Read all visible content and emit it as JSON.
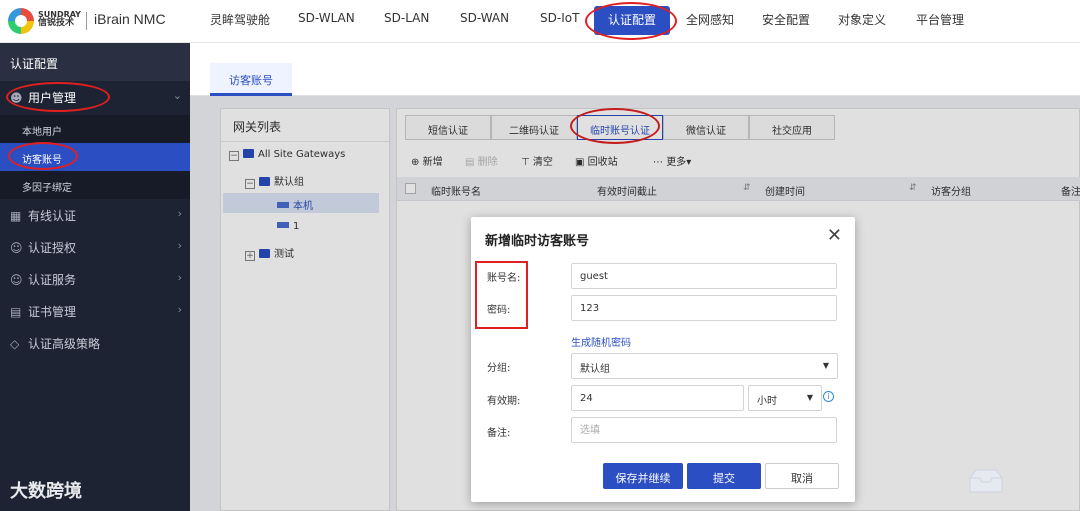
{
  "header": {
    "brand_en": "SUNDRAY",
    "brand_zh": "信锐技术",
    "product": "iBrain NMC",
    "nav": [
      "灵眸驾驶舱",
      "SD-WLAN",
      "SD-LAN",
      "SD-WAN",
      "SD-IoT",
      "认证配置",
      "全网感知",
      "安全配置",
      "对象定义",
      "平台管理"
    ],
    "active_nav": "认证配置"
  },
  "sidebar": {
    "title": "认证配置",
    "user_mgmt": "用户管理",
    "sub_local": "本地用户",
    "sub_guest": "访客账号",
    "sub_multi": "多因子绑定",
    "wired": "有线认证",
    "authz": "认证授权",
    "service": "认证服务",
    "cert": "证书管理",
    "advanced": "认证高级策略",
    "watermark": "大数跨境"
  },
  "page_tab": "访客账号",
  "gateway": {
    "title": "网关列表",
    "root": "All Site Gateways",
    "group": "默认组",
    "node_local": "本机",
    "node_1": "1",
    "group_test": "测试"
  },
  "auth_tabs": [
    "短信认证",
    "二维码认证",
    "临时账号认证",
    "微信认证",
    "社交应用"
  ],
  "active_auth_tab": "临时账号认证",
  "toolbar": {
    "add": "新增",
    "delete": "删除",
    "clear": "清空",
    "recycle": "回收站",
    "more": "更多"
  },
  "table": {
    "columns": [
      "临时账号名",
      "有效时间截止",
      "创建时间",
      "访客分组",
      "备注"
    ]
  },
  "modal": {
    "title": "新增临时访客账号",
    "account_label": "账号名:",
    "account_value": "guest",
    "password_label": "密码:",
    "password_value": "123",
    "gen_password": "生成随机密码",
    "group_label": "分组:",
    "group_value": "默认组",
    "validity_label": "有效期:",
    "validity_value": "24",
    "validity_unit": "小时",
    "remark_label": "备注:",
    "remark_placeholder": "选填",
    "btn_save_continue": "保存并继续",
    "btn_submit": "提交",
    "btn_cancel": "取消"
  },
  "colors": {
    "primary": "#2b4ec2",
    "sidebar_bg": "#1e2333",
    "highlight": "#e02020"
  }
}
